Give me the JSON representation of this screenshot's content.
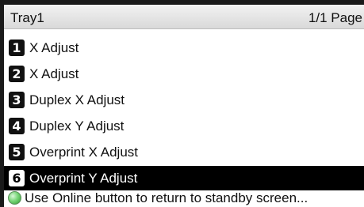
{
  "header": {
    "title": "Tray1",
    "page": "1/1 Page"
  },
  "menu": {
    "items": [
      {
        "number": "1",
        "label": "X Adjust"
      },
      {
        "number": "2",
        "label": "X Adjust"
      },
      {
        "number": "3",
        "label": "Duplex X Adjust"
      },
      {
        "number": "4",
        "label": "Duplex Y Adjust"
      },
      {
        "number": "5",
        "label": "Overprint X Adjust"
      },
      {
        "number": "6",
        "label": "Overprint Y Adjust"
      }
    ],
    "selected_index": 5
  },
  "footer": {
    "icon": "online-button-icon",
    "message": "Use Online button to return to standby screen..."
  },
  "colors": {
    "selected_background": "#000000",
    "selected_text": "#ffffff",
    "online_icon": "#79d679"
  }
}
